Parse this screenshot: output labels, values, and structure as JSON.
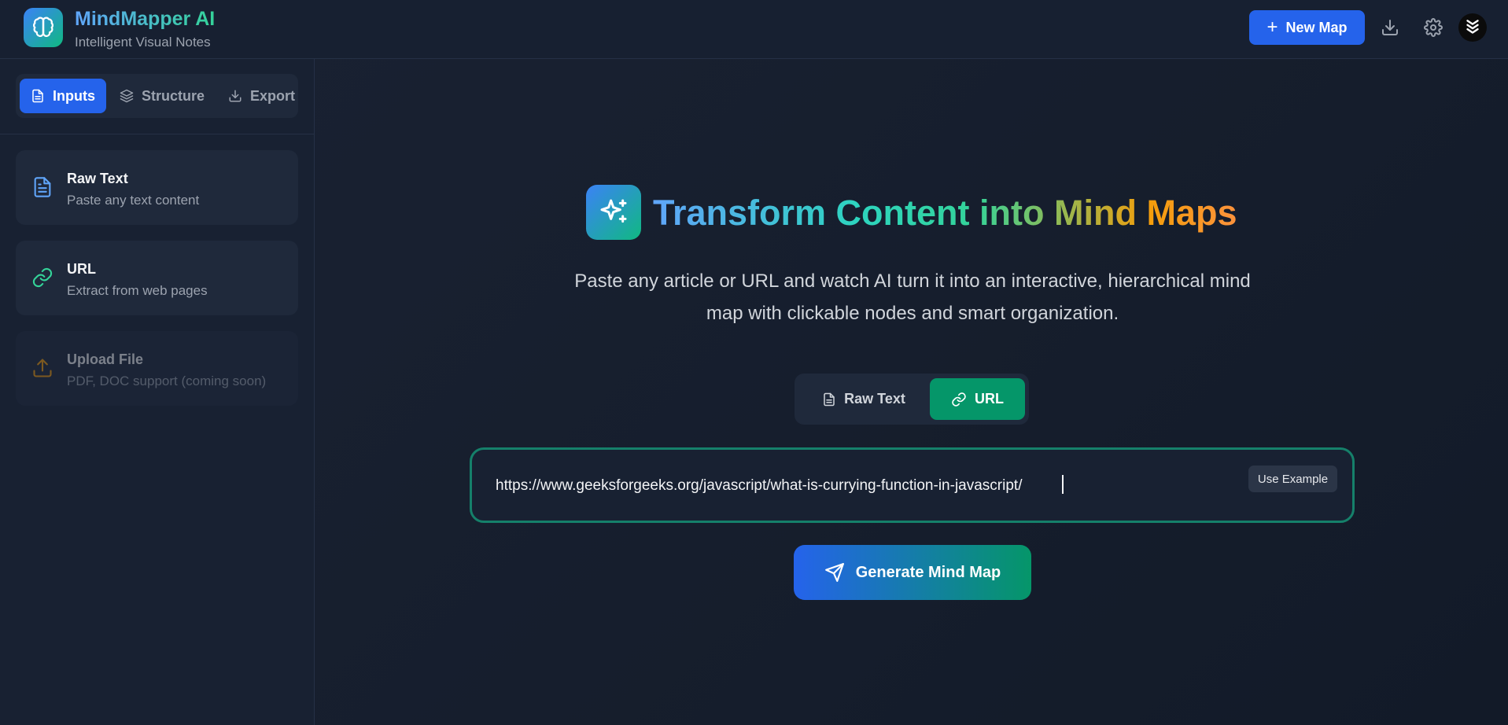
{
  "header": {
    "app_title": "MindMapper AI",
    "app_subtitle": "Intelligent Visual Notes",
    "new_map_label": "New Map"
  },
  "sidebar": {
    "tabs": [
      {
        "label": "Inputs",
        "active": true
      },
      {
        "label": "Structure",
        "active": false
      },
      {
        "label": "Export",
        "active": false
      }
    ],
    "input_options": [
      {
        "title": "Raw Text",
        "description": "Paste any text content",
        "icon": "file-text-icon"
      },
      {
        "title": "URL",
        "description": "Extract from web pages",
        "icon": "link-icon"
      },
      {
        "title": "Upload File",
        "description": "PDF, DOC support (coming soon)",
        "icon": "upload-icon",
        "disabled": true
      }
    ]
  },
  "main": {
    "title": "Transform Content into Mind Maps",
    "description": "Paste any article or URL and watch AI turn it into an interactive, hierarchical mind map with clickable nodes and smart organization.",
    "mode_toggle": [
      {
        "label": "Raw Text",
        "active": false
      },
      {
        "label": "URL",
        "active": true
      }
    ],
    "url_value": "https://www.geeksforgeeks.org/javascript/what-is-currying-function-in-javascript/",
    "use_example_label": "Use Example",
    "generate_label": "Generate Mind Map"
  },
  "colors": {
    "accent_blue": "#2563eb",
    "accent_green": "#059669",
    "background": "#182132"
  }
}
